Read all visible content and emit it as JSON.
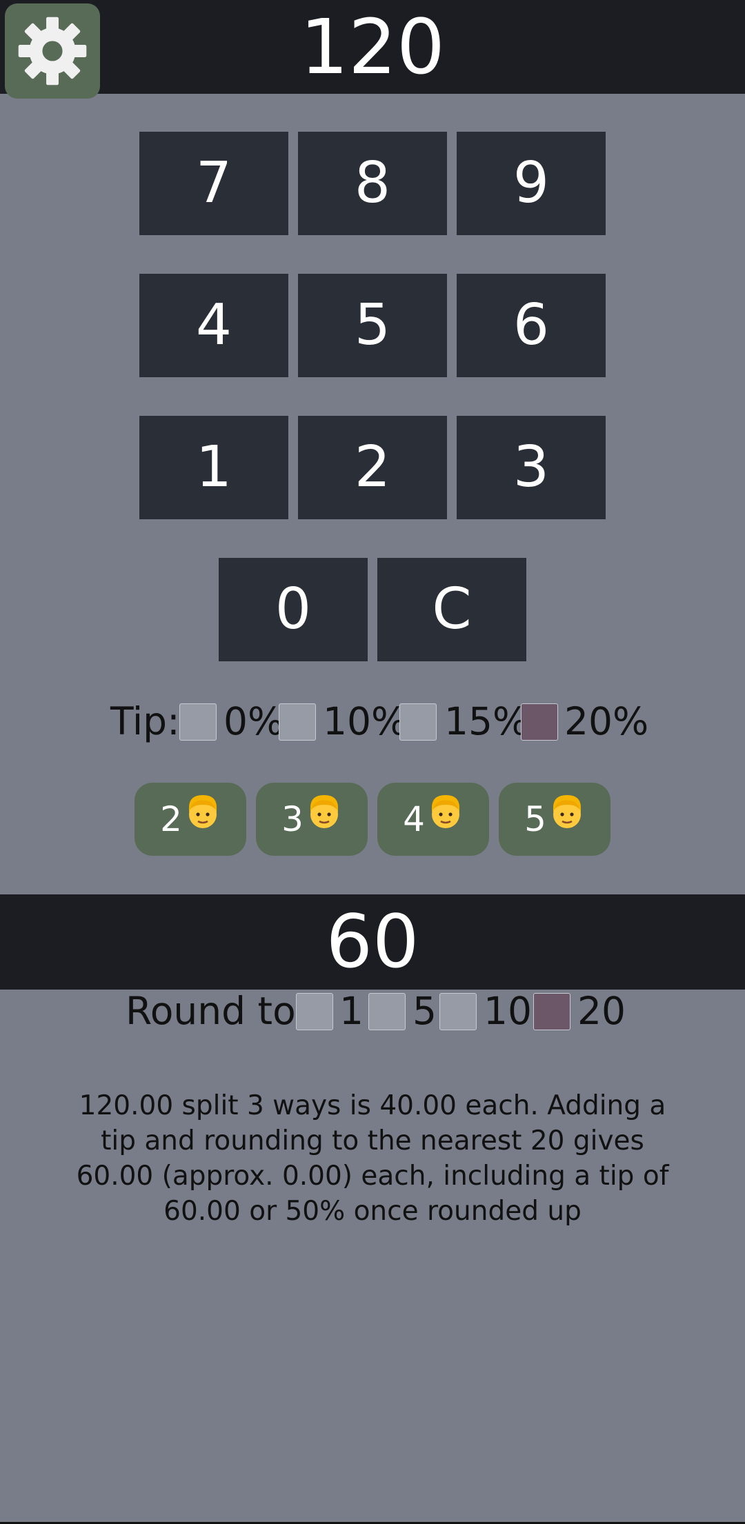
{
  "header": {
    "total": "120"
  },
  "settings": {
    "icon": "gear-icon"
  },
  "keypad": {
    "k7": "7",
    "k8": "8",
    "k9": "9",
    "k4": "4",
    "k5": "5",
    "k6": "6",
    "k1": "1",
    "k2": "2",
    "k3": "3",
    "k0": "0",
    "clear": "C"
  },
  "tip": {
    "label": "Tip:",
    "options": [
      {
        "label": "0%",
        "checked": false
      },
      {
        "label": "10%",
        "checked": false
      },
      {
        "label": "15%",
        "checked": false
      },
      {
        "label": "20%",
        "checked": true
      }
    ]
  },
  "people": {
    "options": [
      {
        "count": "2",
        "icon": "person-emoji-icon"
      },
      {
        "count": "3",
        "icon": "person-emoji-icon"
      },
      {
        "count": "4",
        "icon": "person-emoji-icon"
      },
      {
        "count": "5",
        "icon": "person-emoji-icon"
      }
    ]
  },
  "result": {
    "per_person": "60"
  },
  "round": {
    "label": "Round to:",
    "options": [
      {
        "label": "1",
        "checked": false
      },
      {
        "label": "5",
        "checked": false
      },
      {
        "label": "10",
        "checked": false
      },
      {
        "label": "20",
        "checked": true
      }
    ]
  },
  "summary": "120.00 split 3 ways is 40.00 each. Adding a tip and rounding to the nearest 20 gives 60.00 (approx. 0.00) each, including a tip of 60.00 or 50% once rounded up",
  "colors": {
    "background": "#787d89",
    "bar": "#1b1d22",
    "key": "#2a2e37",
    "accent_green": "#586b57",
    "checkbox_on": "#6b5768",
    "checkbox_off": "#979ba6"
  }
}
